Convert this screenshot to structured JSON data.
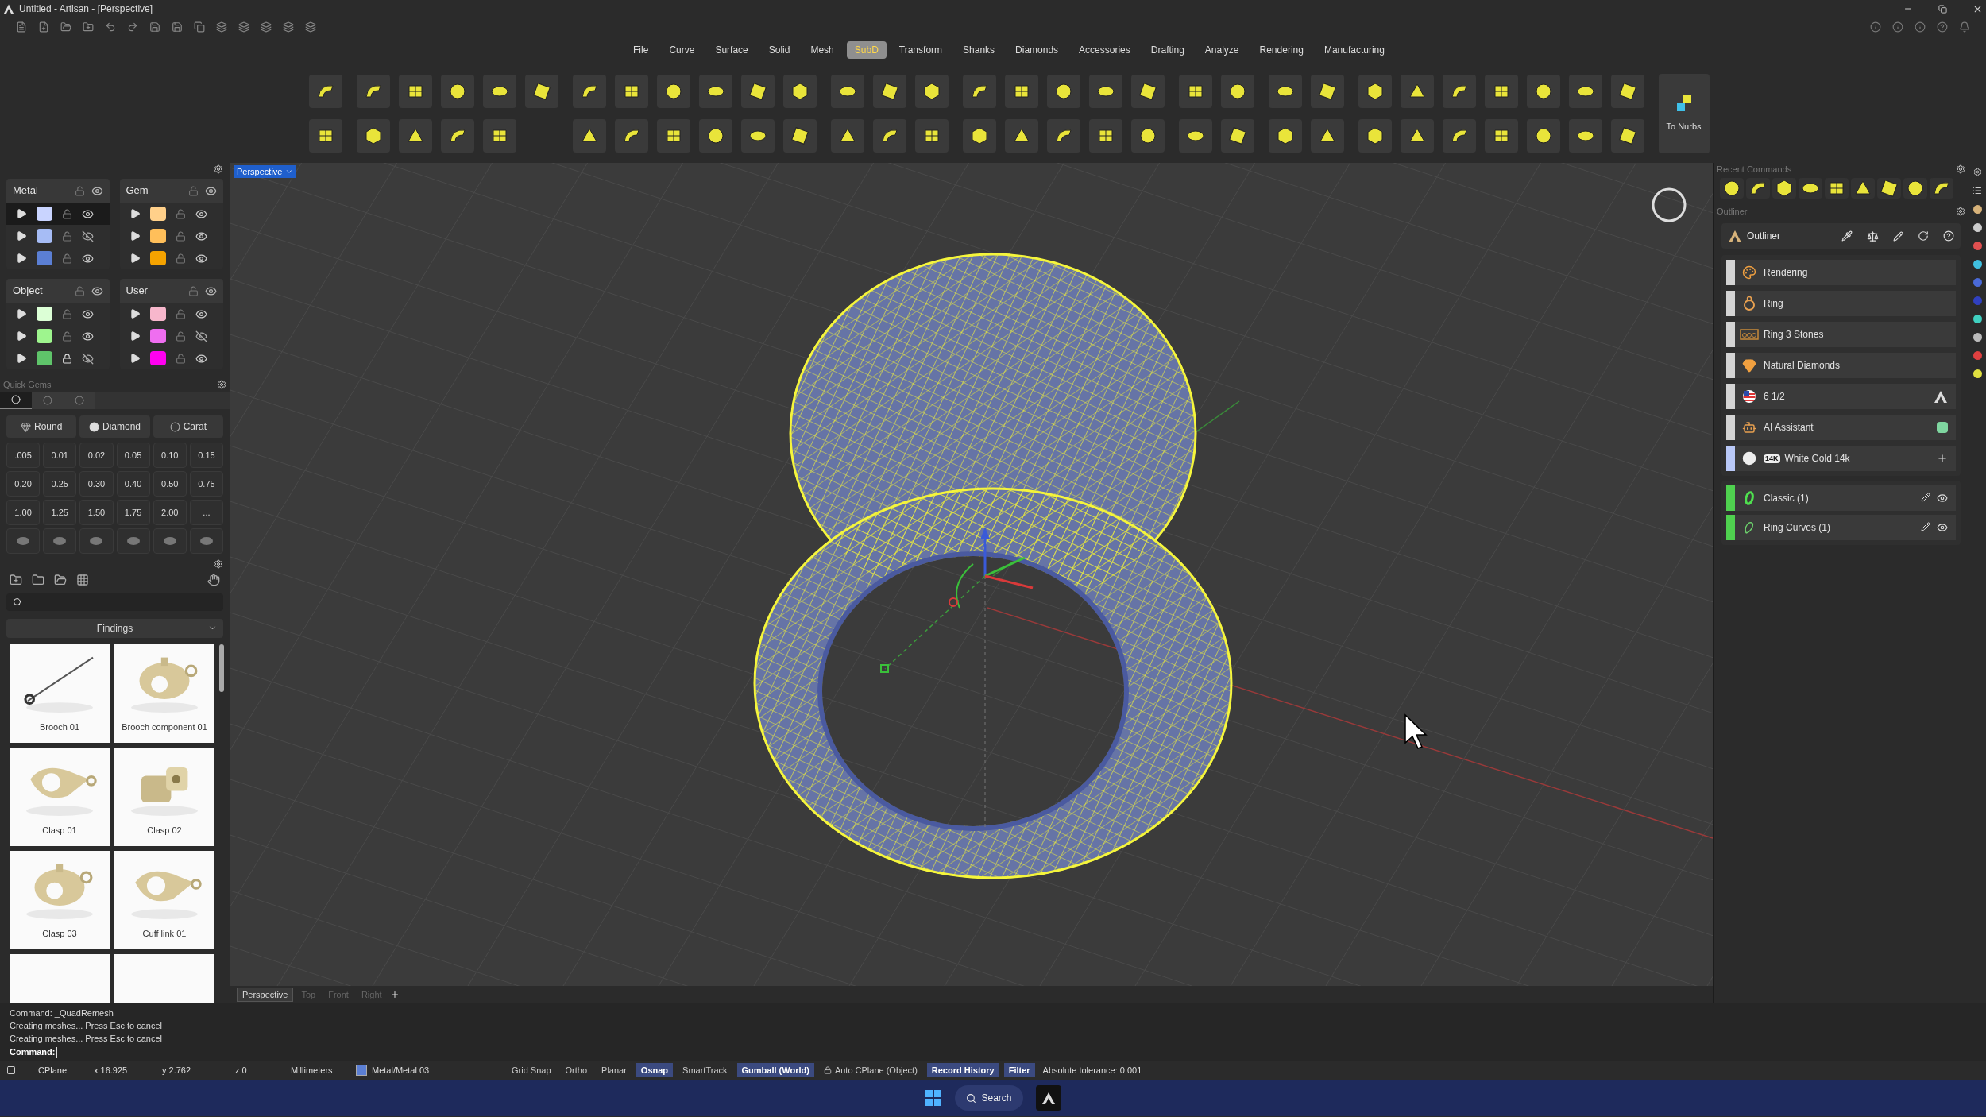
{
  "window": {
    "title": "Untitled - Artisan - [Perspective]"
  },
  "menu": [
    {
      "label": "File",
      "selected": false
    },
    {
      "label": "Curve",
      "selected": false
    },
    {
      "label": "Surface",
      "selected": false
    },
    {
      "label": "Solid",
      "selected": false
    },
    {
      "label": "Mesh",
      "selected": false
    },
    {
      "label": "SubD",
      "selected": true
    },
    {
      "label": "Transform",
      "selected": false
    },
    {
      "label": "Shanks",
      "selected": false
    },
    {
      "label": "Diamonds",
      "selected": false
    },
    {
      "label": "Accessories",
      "selected": false
    },
    {
      "label": "Drafting",
      "selected": false
    },
    {
      "label": "Analyze",
      "selected": false
    },
    {
      "label": "Rendering",
      "selected": false
    },
    {
      "label": "Manufacturing",
      "selected": false
    }
  ],
  "ribbon": {
    "convert_label": "To Nurbs"
  },
  "layer_groups": [
    {
      "name": "Metal",
      "layers": [
        {
          "color": "#c9d4ff",
          "selected": true,
          "locked": false,
          "visible": true
        },
        {
          "color": "#a6bcf5",
          "selected": false,
          "locked": false,
          "visible": false
        },
        {
          "color": "#5b7fd4",
          "selected": false,
          "locked": false,
          "visible": true
        }
      ]
    },
    {
      "name": "Gem",
      "layers": [
        {
          "color": "#ffd08a",
          "selected": false,
          "locked": false,
          "visible": true
        },
        {
          "color": "#ffbf5a",
          "selected": false,
          "locked": false,
          "visible": true
        },
        {
          "color": "#f5a300",
          "selected": false,
          "locked": false,
          "visible": true
        }
      ]
    },
    {
      "name": "Object",
      "layers": [
        {
          "color": "#dcffd6",
          "selected": false,
          "locked": false,
          "visible": true
        },
        {
          "color": "#9ef58e",
          "selected": false,
          "locked": false,
          "visible": true
        },
        {
          "color": "#5fc46a",
          "selected": false,
          "locked": true,
          "visible": false
        }
      ]
    },
    {
      "name": "User",
      "layers": [
        {
          "color": "#f7b7cc",
          "selected": false,
          "locked": false,
          "visible": true
        },
        {
          "color": "#ef6ef0",
          "selected": false,
          "locked": false,
          "visible": false
        },
        {
          "color": "#ff00f0",
          "selected": false,
          "locked": false,
          "visible": true
        }
      ]
    }
  ],
  "quick_gems": {
    "title": "Quick Gems",
    "tabs": [
      {
        "selected": true
      },
      {
        "selected": false
      },
      {
        "selected": false
      }
    ],
    "shape": "Round",
    "material": "Diamond",
    "unit": "Carat",
    "sizes": [
      ".005",
      "0.01",
      "0.02",
      "0.05",
      "0.10",
      "0.15",
      "0.20",
      "0.25",
      "0.30",
      "0.40",
      "0.50",
      "0.75",
      "1.00",
      "1.25",
      "1.50",
      "1.75",
      "2.00",
      "..."
    ]
  },
  "library": {
    "category": "Findings",
    "items": [
      {
        "label": "Brooch 01"
      },
      {
        "label": "Brooch component 01"
      },
      {
        "label": "Clasp 01"
      },
      {
        "label": "Clasp 02"
      },
      {
        "label": "Clasp 03"
      },
      {
        "label": "Cuff link 01"
      }
    ]
  },
  "viewport": {
    "label": "Perspective",
    "tabs": [
      {
        "label": "Perspective",
        "selected": true
      },
      {
        "label": "Top",
        "selected": false
      },
      {
        "label": "Front",
        "selected": false
      },
      {
        "label": "Right",
        "selected": false
      }
    ]
  },
  "recent_commands": {
    "title": "Recent Commands"
  },
  "outliner": {
    "title": "Outliner",
    "header": "Outliner",
    "settings": [
      {
        "label": "Rendering",
        "kind": "rendering",
        "color": "#d4d4d4"
      },
      {
        "label": "Ring",
        "kind": "ring",
        "color": "#d4d4d4"
      },
      {
        "label": "Ring 3 Stones",
        "kind": "stones",
        "color": "#d4d4d4"
      },
      {
        "label": "Natural Diamonds",
        "kind": "diamonds",
        "color": "#d4d4d4"
      },
      {
        "label": "6 1/2",
        "kind": "size",
        "color": "#d4d4d4"
      },
      {
        "label": "AI Assistant",
        "kind": "assistant",
        "color": "#d4d4d4"
      },
      {
        "label": "White Gold 14k",
        "kind": "metal",
        "color": "#b9c8f7",
        "badge": "14K"
      }
    ],
    "layers": [
      {
        "label": "Classic (1)",
        "kind": "profile",
        "color": "#4fd14f"
      },
      {
        "label": "Ring Curves (1)",
        "kind": "curves",
        "color": "#4fd14f"
      }
    ]
  },
  "command_line": {
    "history": [
      "Command: _QuadRemesh",
      "Creating meshes... Press Esc to cancel",
      "Creating meshes... Press Esc to cancel"
    ],
    "prompt": "Command:"
  },
  "status_bar": {
    "cplane": "CPlane",
    "x": "x 16.925",
    "y": "y 2.762",
    "z": "z 0",
    "units": "Millimeters",
    "layer": "Metal/Metal 03",
    "toggles": [
      {
        "label": "Grid Snap",
        "on": false,
        "kind": "toggle"
      },
      {
        "label": "Ortho",
        "on": false,
        "kind": "toggle"
      },
      {
        "label": "Planar",
        "on": false,
        "kind": "toggle"
      },
      {
        "label": "Osnap",
        "on": true,
        "kind": "toggle"
      },
      {
        "label": "SmartTrack",
        "on": false,
        "kind": "toggle"
      },
      {
        "label": "Gumball (World)",
        "on": true,
        "kind": "toggle"
      },
      {
        "label": "Auto CPlane (Object)",
        "on": false,
        "kind": "locked-toggle"
      },
      {
        "label": "Record History",
        "on": true,
        "kind": "toggle"
      },
      {
        "label": "Filter",
        "on": true,
        "kind": "toggle"
      }
    ],
    "tolerance": "Absolute tolerance: 0.001"
  },
  "taskbar": {
    "search": "Search"
  }
}
